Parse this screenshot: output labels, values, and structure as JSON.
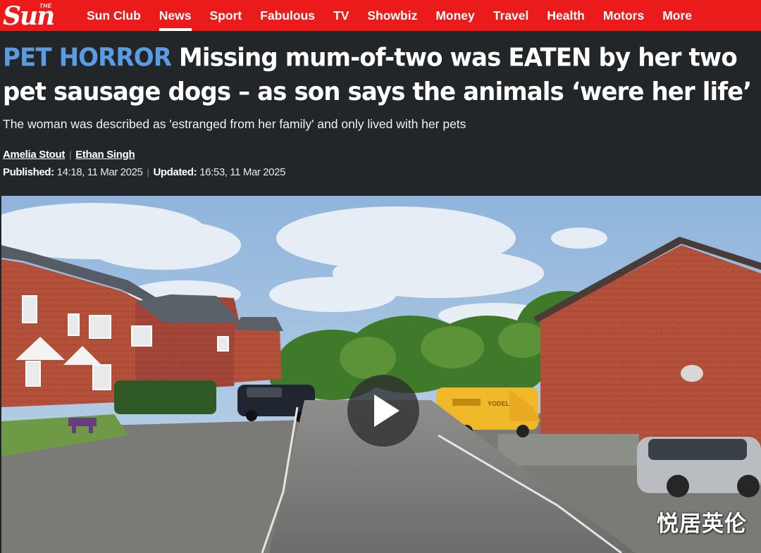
{
  "nav": {
    "logo_small": "THE",
    "logo": "Sun",
    "items": [
      {
        "label": "Sun Club"
      },
      {
        "label": "News"
      },
      {
        "label": "Sport"
      },
      {
        "label": "Fabulous"
      },
      {
        "label": "TV"
      },
      {
        "label": "Showbiz"
      },
      {
        "label": "Money"
      },
      {
        "label": "Travel"
      },
      {
        "label": "Health"
      },
      {
        "label": "Motors"
      },
      {
        "label": "More"
      }
    ],
    "active": "News"
  },
  "article": {
    "kicker": "PET HORROR",
    "headline": "Missing mum-of-two was EATEN by her two pet sausage dogs – as son says the animals ‘were her life’",
    "standfirst": "The woman was described as 'estranged from her family' and only lived with her pets",
    "authors": [
      "Amelia Stout",
      "Ethan Singh"
    ],
    "published_label": "Published:",
    "published": "14:18, 11 Mar 2025",
    "updated_label": "Updated:",
    "updated": "16:53, 11 Mar 2025"
  },
  "media": {
    "watermark": "悦居英伦",
    "van_text": "YODEL"
  },
  "colors": {
    "nav_bg": "#eb1b1b",
    "page_bg": "#222629",
    "kicker": "#5b9be3"
  }
}
